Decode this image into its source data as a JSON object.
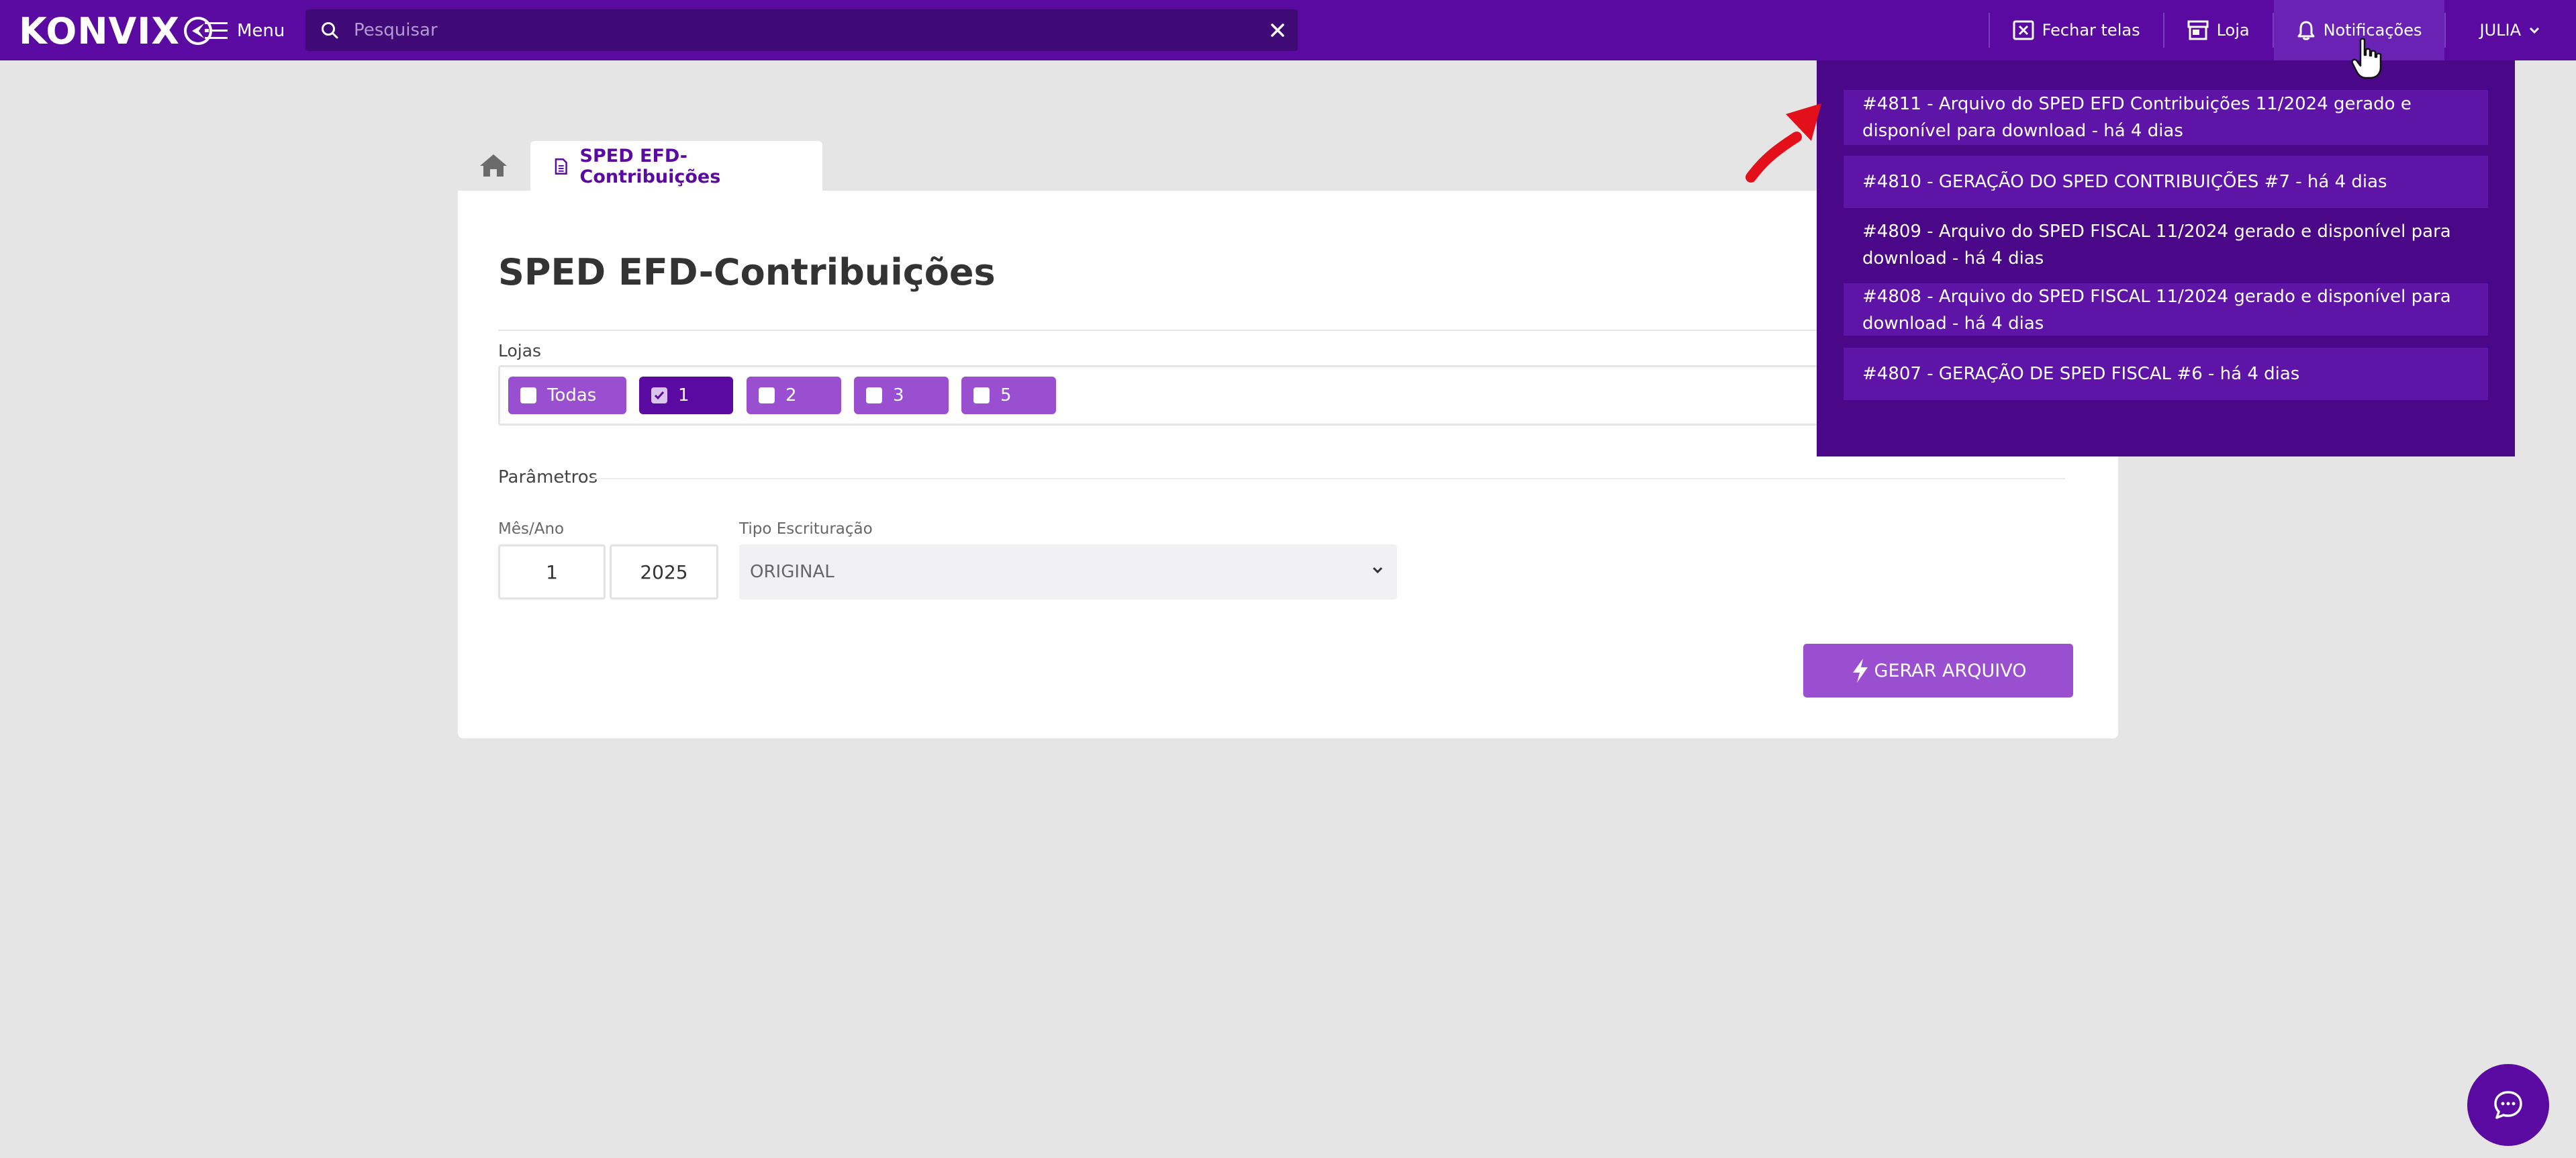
{
  "colors": {
    "brand": "#5a0aa0",
    "brand_dark": "#3f0a75",
    "chip": "#9a4fd1",
    "chip_selected": "#5a0aa0",
    "dropdown": "#4a0888",
    "arrow": "#e3101b"
  },
  "topbar": {
    "logo": "KONVIX",
    "menu_label": "Menu",
    "search_placeholder": "Pesquisar",
    "actions": {
      "close_screens": "Fechar telas",
      "store": "Loja",
      "notifications": "Notificações",
      "user": "JULIA"
    }
  },
  "tabs": {
    "home_icon": "home-icon",
    "active": "SPED EFD-Contribuições"
  },
  "form": {
    "title": "SPED EFD-Contribuições",
    "lojas_label": "Lojas",
    "lojas": [
      {
        "label": "Todas",
        "checked": false
      },
      {
        "label": "1",
        "checked": true
      },
      {
        "label": "2",
        "checked": false
      },
      {
        "label": "3",
        "checked": false
      },
      {
        "label": "5",
        "checked": false
      }
    ],
    "params_label": "Parâmetros",
    "mes_ano_label": "Mês/Ano",
    "month": "1",
    "year": "2025",
    "tipo_label": "Tipo Escrituração",
    "tipo_value": "ORIGINAL",
    "generate_button": "GERAR ARQUIVO"
  },
  "notifications": [
    {
      "text": "#4811 - Arquivo do SPED EFD Contribuições 11/2024 gerado e disponível para download - há 4 dias"
    },
    {
      "text": "#4810 - GERAÇÃO DO SPED CONTRIBUIÇÕES #7 - há 4 dias"
    },
    {
      "text": "#4809 - Arquivo do SPED FISCAL 11/2024 gerado e disponível para download - há 4 dias"
    },
    {
      "text": "#4808 - Arquivo do SPED FISCAL 11/2024 gerado e disponível para download - há 4 dias"
    },
    {
      "text": "#4807 - GERAÇÃO DE SPED FISCAL #6 - há 4 dias"
    }
  ]
}
